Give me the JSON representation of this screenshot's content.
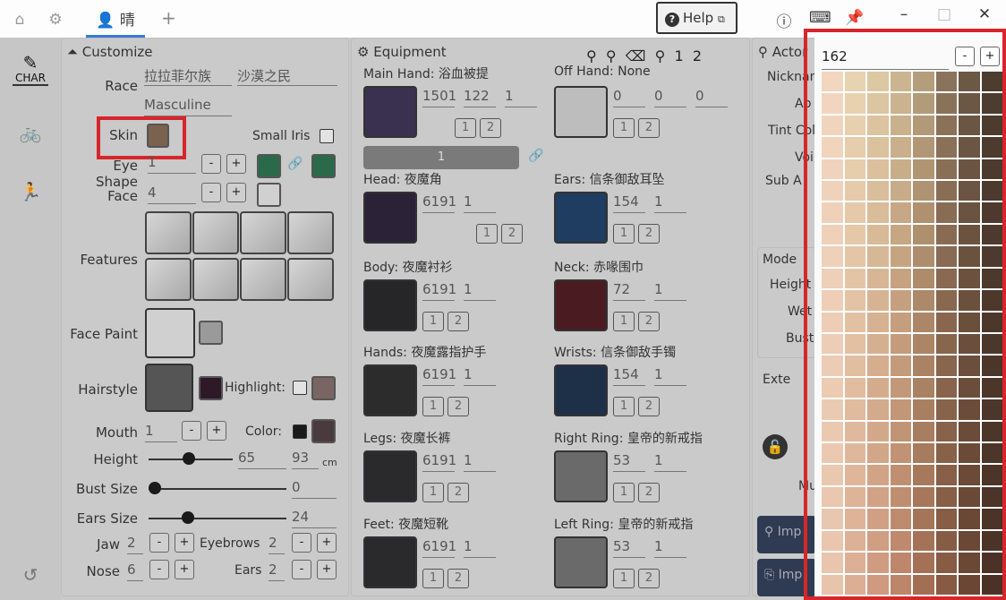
{
  "tabs": {
    "active": "晴",
    "plus": "+"
  },
  "help": {
    "label": "Help"
  },
  "sidebar": {
    "char_label": "CHAR"
  },
  "customize": {
    "header": "Customize",
    "race_label": "Race",
    "race_value": "拉拉菲尔族",
    "tribe_value": "沙漠之民",
    "gender_value": "Masculine",
    "skin_label": "Skin",
    "skin_color": "#7b6150",
    "small_iris_label": "Small Iris",
    "eye_shape_label": "Eye Shape",
    "eye_shape_value": "1",
    "eye_color_left": "#2a6a4a",
    "eye_color_right": "#2a6a4a",
    "face_label": "Face",
    "face_value": "4",
    "features_label": "Features",
    "face_paint_label": "Face Paint",
    "hairstyle_label": "Hairstyle",
    "hair_color": "#2e1a26",
    "highlight_label": "Highlight:",
    "highlight_color": "#7a6565",
    "mouth_label": "Mouth",
    "mouth_value": "1",
    "color_label": "Color:",
    "lip_color": "#4a3a3e",
    "height_label": "Height",
    "height_value": "65",
    "height_cm": "93",
    "cm": "cm",
    "height_level": 0.4,
    "bust_label": "Bust Size",
    "bust_value": "0",
    "bust_level": 0.0,
    "ears_label": "Ears Size",
    "ears_value": "24",
    "ears_level": 0.24,
    "jaw_label": "Jaw",
    "jaw_value": "2",
    "eyebrows_label": "Eyebrows",
    "eyebrows_value": "2",
    "nose_label": "Nose",
    "nose_value": "6",
    "ears2_label": "Ears",
    "ears2_value": "2",
    "minus": "-",
    "plus": "+"
  },
  "equipment": {
    "header": "Equipment",
    "count1": "1",
    "count2": "2",
    "main_hand": {
      "label": "Main Hand: 浴血被提",
      "v1": "1501",
      "v2": "122",
      "v3": "1"
    },
    "off_hand": {
      "label": "Off Hand: None",
      "v1": "0",
      "v2": "0",
      "v3": "0"
    },
    "weapon_bar": "1",
    "head": {
      "label": "Head: 夜魔角",
      "v1": "6191",
      "v2": "1"
    },
    "ears": {
      "label": "Ears: 信条御敌耳坠",
      "v1": "154",
      "v2": "1"
    },
    "body": {
      "label": "Body: 夜魔衬衫",
      "v1": "6191",
      "v2": "1"
    },
    "neck": {
      "label": "Neck: 赤喙围巾",
      "v1": "72",
      "v2": "1"
    },
    "hands": {
      "label": "Hands: 夜魔露指护手",
      "v1": "6191",
      "v2": "1"
    },
    "wrists": {
      "label": "Wrists: 信条御敌手镯",
      "v1": "154",
      "v2": "1"
    },
    "legs": {
      "label": "Legs: 夜魔长裤",
      "v1": "6191",
      "v2": "1"
    },
    "right_ring": {
      "label": "Right Ring: 皇帝的新戒指",
      "v1": "53",
      "v2": "1"
    },
    "feet": {
      "label": "Feet: 夜魔短靴",
      "v1": "6191",
      "v2": "1"
    },
    "left_ring": {
      "label": "Left Ring: 皇帝的新戒指",
      "v1": "53",
      "v2": "1"
    },
    "dye1": "1",
    "dye2": "2"
  },
  "actor": {
    "header": "Actor",
    "nick": "Nicknam",
    "ap": "Ap",
    "tint": "Tint Col",
    "voice": "Voi",
    "sub": "Sub A",
    "model": "Mode",
    "height": "Height",
    "wt": "Wet",
    "bust": "Bust",
    "ext": "Exte",
    "mu": "Mu",
    "import1": "Imp",
    "import2": "Imp"
  },
  "picker": {
    "value": "162",
    "minus": "-",
    "plus": "+",
    "columns": [
      "#f2d6bf",
      "#e8d3b0",
      "#dcc8a2",
      "#cbb590",
      "#b39d7a",
      "#8a735a",
      "#6b5845",
      "#4d3c30"
    ],
    "bottom_columns": [
      "#e8c4ab",
      "#dcae94",
      "#cf9a80",
      "#bd8569",
      "#a36f54",
      "#875a43",
      "#6b4634",
      "#4c3226"
    ]
  }
}
